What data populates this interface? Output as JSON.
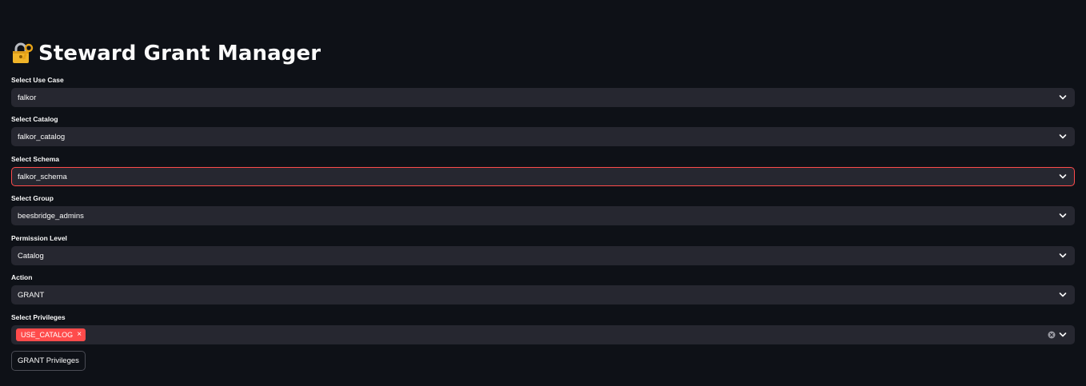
{
  "app": {
    "title": "Steward Grant Manager",
    "title_icon": "lock-with-key-icon"
  },
  "fields": {
    "use_case": {
      "label": "Select Use Case",
      "value": "falkor"
    },
    "catalog": {
      "label": "Select Catalog",
      "value": "falkor_catalog"
    },
    "schema": {
      "label": "Select Schema",
      "value": "falkor_schema"
    },
    "group": {
      "label": "Select Group",
      "value": "beesbridge_admins"
    },
    "permission_level": {
      "label": "Permission Level",
      "value": "Catalog"
    },
    "action": {
      "label": "Action",
      "value": "GRANT"
    },
    "privileges": {
      "label": "Select Privileges",
      "selected": [
        "USE_CATALOG"
      ],
      "tag_remove": "×"
    }
  },
  "buttons": {
    "grant_label": "GRANT Privileges"
  },
  "colors": {
    "background": "#0e1117",
    "input_bg": "#262730",
    "accent": "#ff4b4b",
    "text": "#fafafa"
  },
  "icons": {
    "dropdown": "chevron-down-icon",
    "clear": "clear-circle-icon",
    "tag_remove": "close-icon"
  }
}
